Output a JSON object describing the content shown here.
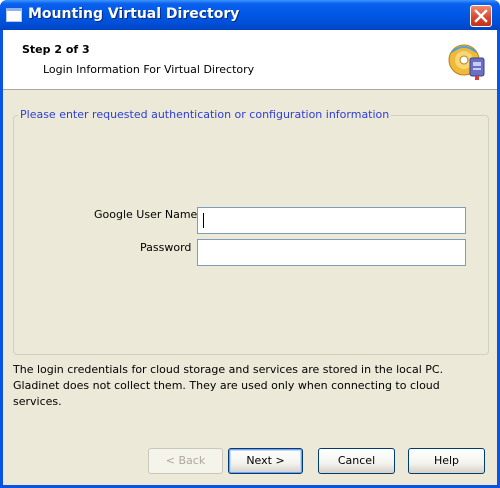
{
  "window": {
    "title": "Mounting Virtual Directory"
  },
  "header": {
    "step": "Step 2 of 3",
    "subtitle": "Login Information For Virtual Directory"
  },
  "group": {
    "legend": "Please enter requested authentication or configuration information"
  },
  "form": {
    "user_label": "Google User Name",
    "user_value": "",
    "password_label": "Password",
    "password_value": ""
  },
  "note": "The login credentials for cloud storage and services are stored in the local PC. Gladinet does not collect them. They are used only when connecting to cloud services.",
  "buttons": {
    "back": "< Back",
    "next": "Next >",
    "cancel": "Cancel",
    "help": "Help"
  },
  "icons": {
    "title": "window-app-icon",
    "close": "close-icon",
    "header": "disk-network-icon"
  },
  "colors": {
    "titlebar": "#0058e6",
    "legend_text": "#2c3fd4",
    "close_button": "#d8432a"
  }
}
